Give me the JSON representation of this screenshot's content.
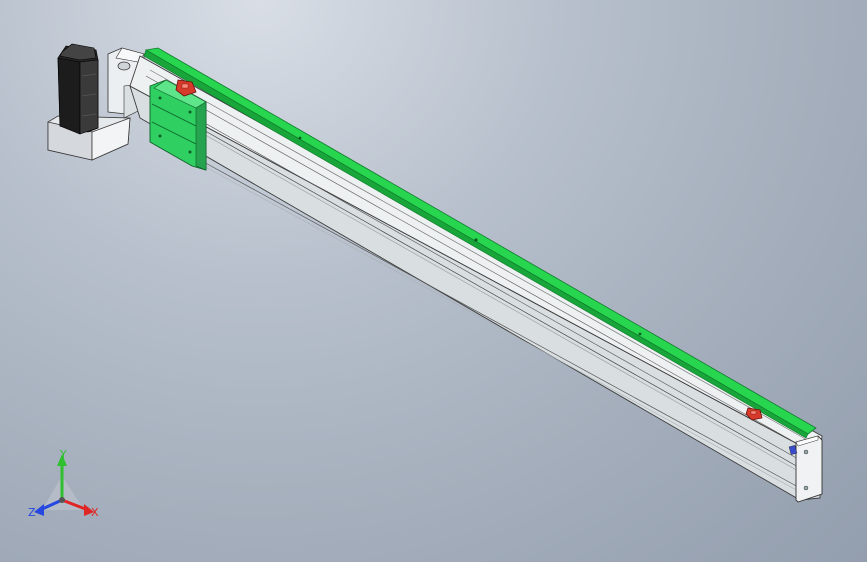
{
  "viewport": {
    "background_top": "#d9dee6",
    "background_bottom": "#939eae"
  },
  "model": {
    "rail_color": "#dfe4e6",
    "rail_shadow": "#b9c0c4",
    "strip_color": "#27d54f",
    "strip_dark": "#18a53a",
    "carriage_color": "#2fcf62",
    "sensor_color": "#d63a2a",
    "motor_color": "#2a2a2a",
    "bracket_color": "#e9ecee"
  },
  "triad": {
    "x_label": "X",
    "y_label": "Y",
    "z_label": "Z",
    "x_color": "#e02525",
    "y_color": "#2fbf2f",
    "z_color": "#2548e0"
  }
}
